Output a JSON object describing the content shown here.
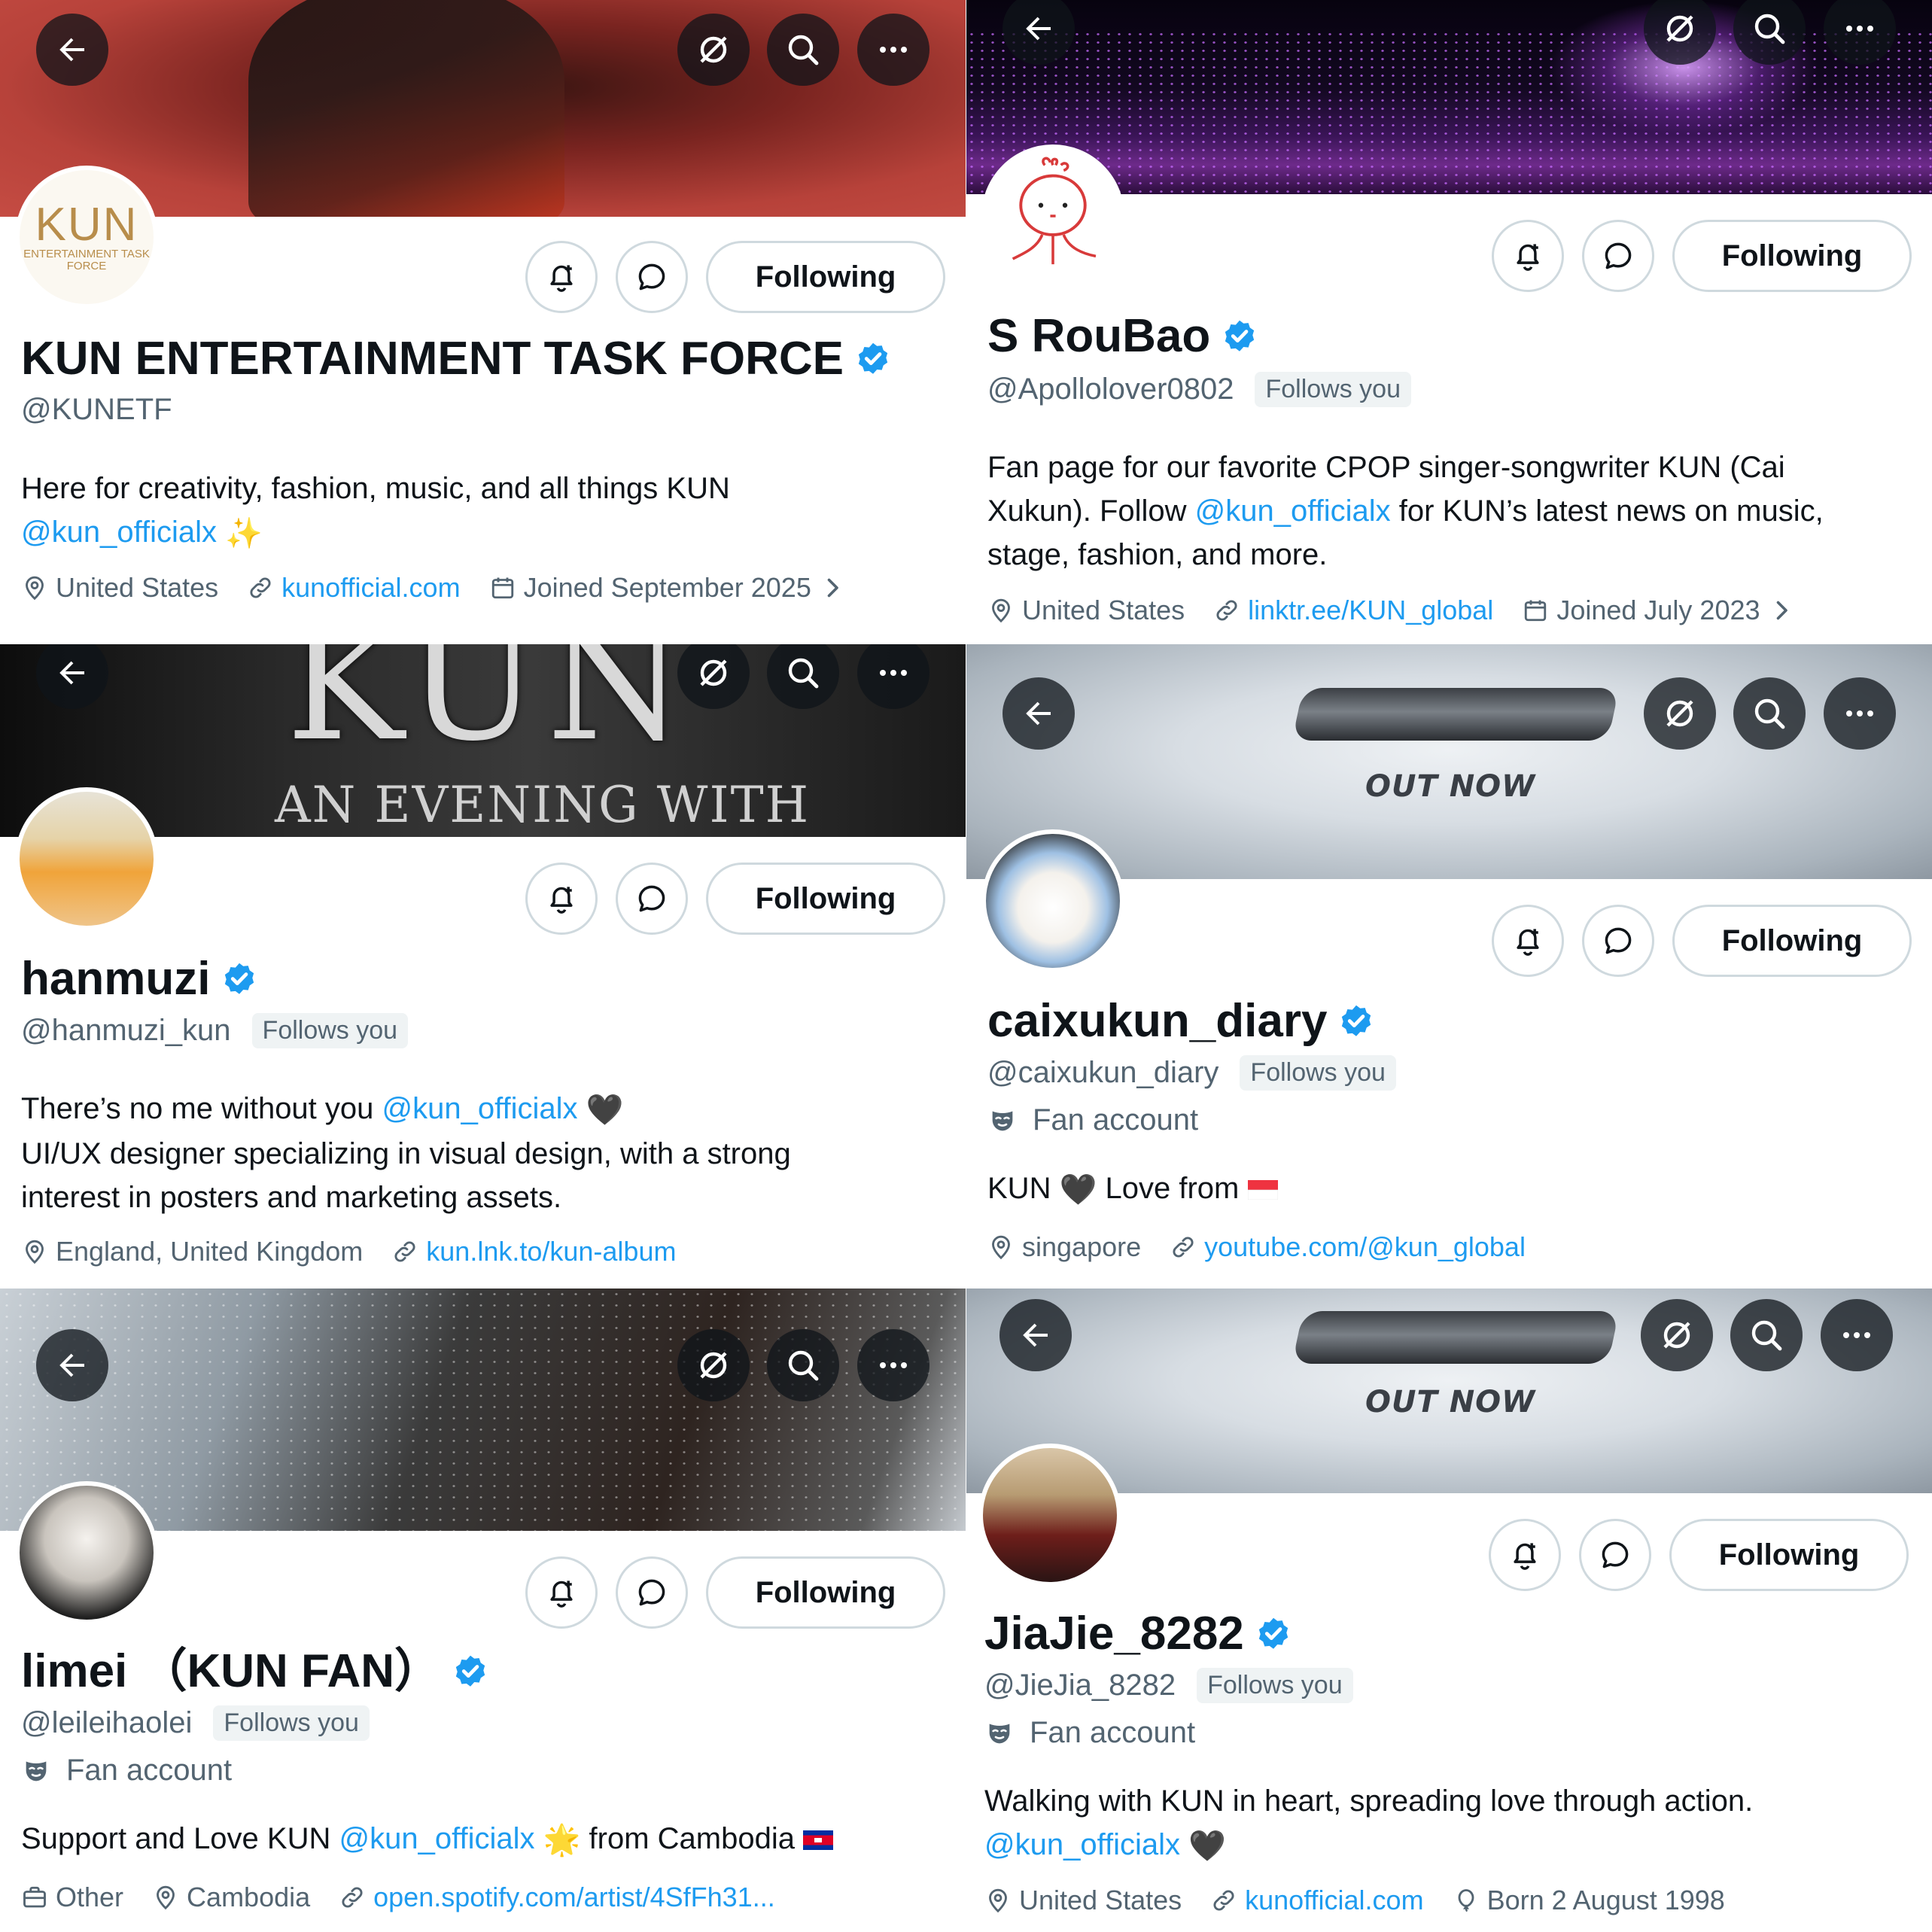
{
  "colors": {
    "accent": "#1d9bf0",
    "text": "#0f1419",
    "secondary": "#536471",
    "border": "#cfd9de",
    "follows_you_bg": "#eff3f4"
  },
  "icons": {
    "header": [
      "back-arrow-icon",
      "unmute-icon",
      "search-icon",
      "more-icon"
    ],
    "actions": [
      "notification-bell-plus-icon",
      "message-icon"
    ],
    "meta": [
      "location-pin-icon",
      "link-icon",
      "calendar-icon",
      "birthday-balloon-icon",
      "briefcase-icon",
      "fan-mask-icon"
    ]
  },
  "profiles": [
    {
      "avatar_text": "KUN",
      "avatar_subtext": "ENTERTAINMENT TASK FORCE",
      "follow_label": "Following",
      "name": "KUN ENTERTAINMENT TASK FORCE",
      "handle": "@KUNETF",
      "bio_1": "Here for creativity, fashion, music, and all things KUN",
      "bio_mention": "@kun_officialx",
      "location": "United States",
      "website": "kunofficial.com",
      "joined": "Joined September 2025"
    },
    {
      "follow_label": "Following",
      "name": "S RouBao",
      "handle": "@Apollolover0802",
      "follows_you": "Follows you",
      "bio_line1": "Fan page for our favorite CPOP singer-songwriter KUN (Cai",
      "bio_line2_a": "Xukun). Follow ",
      "bio_mention": "@kun_officialx",
      "bio_line2_b": " for KUN’s latest news on music,",
      "bio_line3": "stage, fashion, and more.",
      "location": "United States",
      "website": "linktr.ee/KUN_global",
      "joined": "Joined July 2023"
    },
    {
      "banner_title": "KUN",
      "banner_subtitle": "AN EVENING WITH",
      "follow_label": "Following",
      "name": "hanmuzi",
      "handle": "@hanmuzi_kun",
      "follows_you": "Follows you",
      "bio_1": "There’s no me without you ",
      "bio_mention": "@kun_officialx",
      "bio_line2": "UI/UX designer specializing in visual design, with a strong",
      "bio_line3": "interest in posters and marketing assets.",
      "location": "England, United Kingdom",
      "website": "kun.lnk.to/kun-album"
    },
    {
      "banner_text": "OUT NOW",
      "follow_label": "Following",
      "name": "caixukun_diary",
      "handle": "@caixukun_diary",
      "follows_you": "Follows you",
      "category": "Fan account",
      "bio_1": "KUN",
      "bio_2": "Love from",
      "location": "singapore",
      "website": "youtube.com/@kun_global"
    },
    {
      "follow_label": "Following",
      "name": "limei （KUN FAN）",
      "handle": "@leileihaolei",
      "follows_you": "Follows you",
      "category": "Fan account",
      "bio_1": "Support and Love KUN ",
      "bio_mention": "@kun_officialx",
      "bio_2": " from Cambodia",
      "profession": "Other",
      "location": "Cambodia",
      "website": "open.spotify.com/artist/4SfFh31..."
    },
    {
      "banner_text": "OUT NOW",
      "follow_label": "Following",
      "name": "JiaJie_8282",
      "handle": "@JieJia_8282",
      "follows_you": "Follows you",
      "category": "Fan account",
      "bio_line1": "Walking with KUN in heart, spreading love through action.",
      "bio_mention": "@kun_officialx",
      "location": "United States",
      "website": "kunofficial.com",
      "born": "Born 2 August 1998"
    }
  ]
}
